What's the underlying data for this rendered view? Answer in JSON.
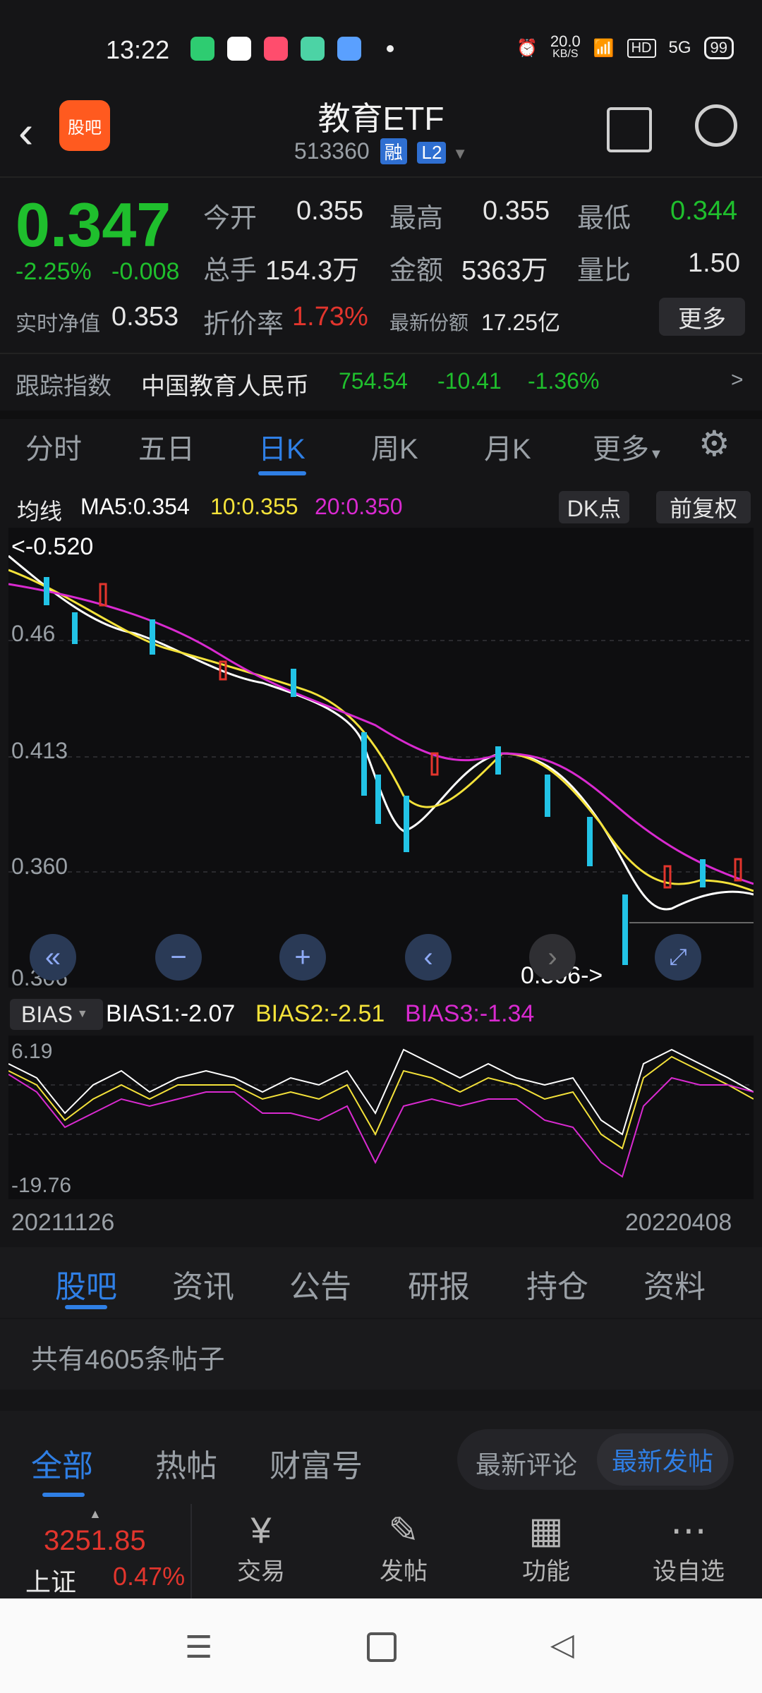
{
  "status_bar": {
    "time": "13:22",
    "net_speed_top": "20.0",
    "net_speed_bottom": "KB/S",
    "hd": "HD",
    "signal": "5G",
    "battery": "99"
  },
  "header": {
    "logo_text": "股吧",
    "title": "教育ETF",
    "code": "513360",
    "rong": "融",
    "level": "L2"
  },
  "quote": {
    "price": "0.347",
    "change_pct": "-2.25%",
    "change": "-0.008",
    "open_label": "今开",
    "open": "0.355",
    "high_label": "最高",
    "high": "0.355",
    "low_label": "最低",
    "low": "0.344",
    "volume_label": "总手",
    "volume": "154.3万",
    "amount_label": "金额",
    "amount": "5363万",
    "ratio_label": "量比",
    "ratio": "1.50",
    "nav_label": "实时净值",
    "nav": "0.353",
    "discount_label": "折价率",
    "discount": "1.73%",
    "shares_label": "最新份额",
    "shares": "17.25亿",
    "more_button": "更多"
  },
  "index": {
    "label": "跟踪指数",
    "name": "中国教育人民币",
    "value": "754.54",
    "change": "-10.41",
    "change_pct": "-1.36%",
    "arrow": ">"
  },
  "period_tabs": [
    "分时",
    "五日",
    "日K",
    "周K",
    "月K",
    "更多"
  ],
  "ma": {
    "label": "均线",
    "ma5": "MA5:0.354",
    "ma10": "10:0.355",
    "ma20": "20:0.350",
    "dk_button": "DK点",
    "adj_button": "前复权"
  },
  "chart_labels": {
    "top_marker": "<-0.520",
    "y1": "0.46",
    "y2": "0.413",
    "y3": "0.360",
    "y4": "0.306",
    "low_marker": "0.306->"
  },
  "bias": {
    "select": "BIAS",
    "bias1": "BIAS1:-2.07",
    "bias2": "BIAS2:-2.51",
    "bias3": "BIAS3:-1.34",
    "top": "6.19",
    "bottom": "-19.76",
    "date_start": "20211126",
    "date_end": "20220408"
  },
  "section_tabs": [
    "股吧",
    "资讯",
    "公告",
    "研报",
    "持仓",
    "资料"
  ],
  "post_count": "共有4605条帖子",
  "post_filters": {
    "tabs": [
      "全部",
      "热帖",
      "财富号"
    ],
    "sort_latest_comment": "最新评论",
    "sort_latest_post": "最新发帖"
  },
  "bottom_nav": {
    "index_value": "3251.85",
    "index_name": "上证",
    "index_pct": "0.47%",
    "items": [
      "交易",
      "发帖",
      "功能",
      "设自选"
    ]
  },
  "colors": {
    "up": "#e2352d",
    "down": "#1fbf2d",
    "accent": "#2f7fe5",
    "ma5": "#ffffff",
    "ma10": "#f4e23a",
    "ma20": "#d92ad0",
    "candle_down": "#22c3e6"
  }
}
